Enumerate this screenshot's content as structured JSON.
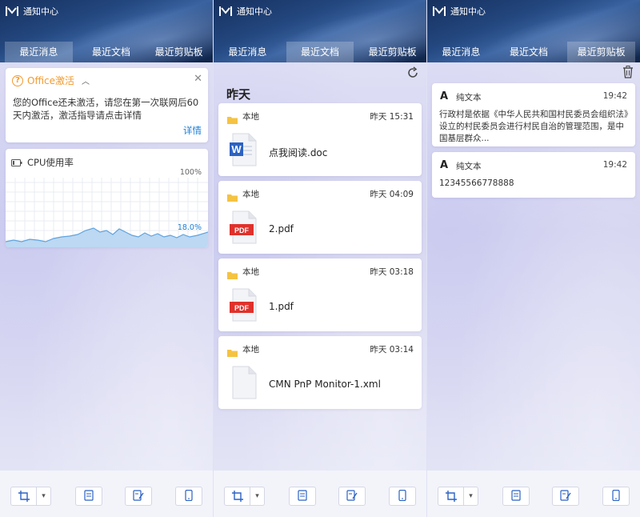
{
  "app": {
    "title": "通知中心"
  },
  "tabs": [
    "最近消息",
    "最近文档",
    "最近剪贴板"
  ],
  "messages": {
    "office": {
      "title": "Office激活",
      "body": "您的Office还未激活，请您在第一次联网后60天内激活，激活指导请点击详情",
      "detail_link": "详情"
    },
    "cpu": {
      "title": "CPU使用率",
      "max_label": "100%",
      "current_label": "18.0%",
      "usage_percent": 18.0
    }
  },
  "documents": {
    "section_title": "昨天",
    "files": [
      {
        "location": "本地",
        "time": "昨天 15:31",
        "name": "点我阅读.doc",
        "type": "word"
      },
      {
        "location": "本地",
        "time": "昨天 04:09",
        "name": "2.pdf",
        "type": "pdf"
      },
      {
        "location": "本地",
        "time": "昨天 03:18",
        "name": "1.pdf",
        "type": "pdf"
      },
      {
        "location": "本地",
        "time": "昨天 03:14",
        "name": "CMN PnP Monitor-1.xml",
        "type": "generic"
      }
    ]
  },
  "clipboard": {
    "items": [
      {
        "type_label": "纯文本",
        "time": "19:42",
        "text": "行政村是依据《中华人民共和国村民委员会组织法》设立的村民委员会进行村民自治的管理范围，是中国基层群众..."
      },
      {
        "type_label": "纯文本",
        "time": "19:42",
        "text": "12345566778888"
      }
    ]
  },
  "icons": {
    "pdf_badge": "PDF",
    "word_badge": "W",
    "text_type_glyph": "A"
  },
  "colors": {
    "accent_blue": "#1a7fd8",
    "warning_orange": "#f29a2e",
    "pdf_red": "#e0312b",
    "word_blue": "#2b62c4",
    "folder_yellow": "#f5c342"
  }
}
